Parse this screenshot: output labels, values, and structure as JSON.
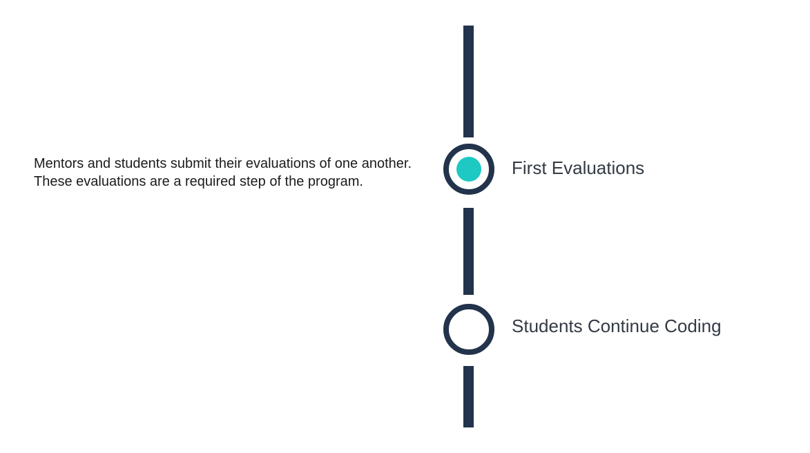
{
  "description": "Mentors and students submit their evaluations of one another. These evaluations are a required step of the program.",
  "timeline": {
    "steps": [
      {
        "label": "First Evaluations",
        "state": "active"
      },
      {
        "label": "Students Continue Coding",
        "state": "upcoming"
      }
    ]
  },
  "colors": {
    "line": "#22334b",
    "active_dot": "#1ec8c3",
    "label_text": "#333a44"
  }
}
